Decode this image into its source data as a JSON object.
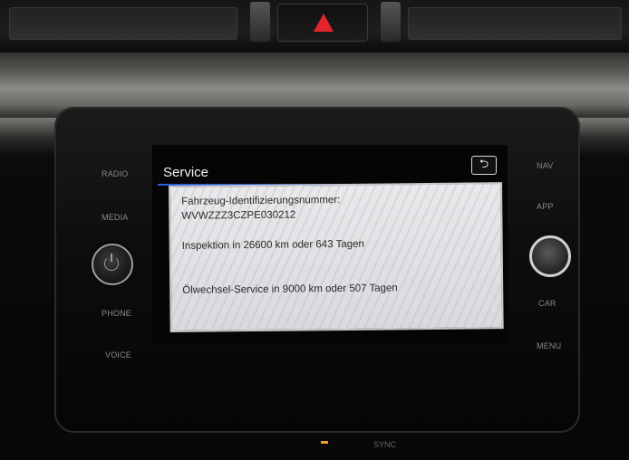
{
  "head_unit": {
    "left_buttons": {
      "radio": "RADIO",
      "media": "MEDIA",
      "phone": "PHONE",
      "voice": "VOICE"
    },
    "right_buttons": {
      "nav": "NAV",
      "app": "APP",
      "car": "CAR",
      "menu": "MENU"
    }
  },
  "screen": {
    "title": "Service",
    "back_icon": "back-arrow-icon",
    "back_glyph": "⮌",
    "lines": {
      "vin_label": "Fahrzeug-Identifizierungsnummer:",
      "vin_value": "WVWZZZ3CZPE030212",
      "inspection": "Inspektion in 26600 km oder 643 Tagen",
      "oil_service": "Ölwechsel-Service in 9000 km oder 507 Tagen"
    }
  },
  "bottom_controls": {
    "sync": "SYNC"
  },
  "colors": {
    "accent_line": "#2b5fd6",
    "hazard": "#e1262c"
  }
}
